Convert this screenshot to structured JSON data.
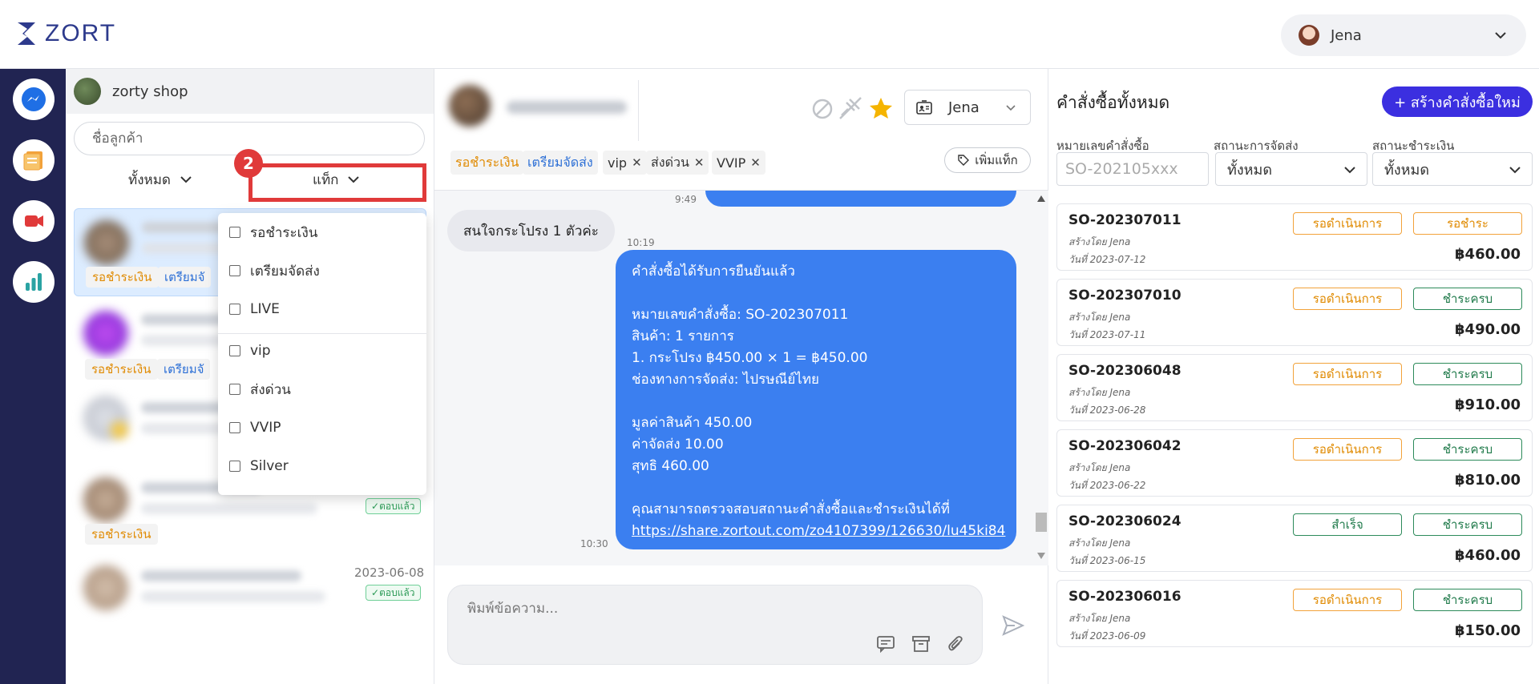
{
  "brand": {
    "name": "ZORT"
  },
  "user_menu": {
    "name": "Jena",
    "icon": "chevron-down-icon"
  },
  "rail": {
    "items": [
      {
        "name": "messenger-icon",
        "color": "#1f6fe5"
      },
      {
        "name": "orders-icon",
        "color": "#f2a23a"
      },
      {
        "name": "live-video-icon",
        "color": "#e03a3a"
      },
      {
        "name": "reports-chart-icon",
        "color": "#2aa3a3"
      }
    ]
  },
  "customer_panel": {
    "shop_name": "zorty shop",
    "search_placeholder": "ชื่อลูกค้า",
    "filter_all": "ทั้งหมด",
    "filter_tag": "แท็ก",
    "step_marker": "2",
    "conversations": [
      {
        "tags": [
          "รอชำระเงิน",
          "เตรียมจั"
        ],
        "time": "",
        "replied": ""
      },
      {
        "tags": [
          "รอชำระเงิน",
          "เตรียมจั"
        ],
        "time": "",
        "replied": ""
      },
      {
        "tags": [],
        "time": "",
        "replied": ""
      },
      {
        "tags": [
          "รอชำระเงิน"
        ],
        "time": "",
        "replied": "ตอบแล้ว"
      },
      {
        "tags": [],
        "time": "2023-06-08",
        "replied": "ตอบแล้ว"
      }
    ]
  },
  "tag_dropdown": {
    "options": [
      "รอชำระเงิน",
      "เตรียมจัดส่ง",
      "LIVE",
      "vip",
      "ส่งด่วน",
      "VVIP",
      "Silver"
    ]
  },
  "chat": {
    "assignee": "Jena",
    "tags": [
      {
        "label": "รอชำระเงิน",
        "removable": false
      },
      {
        "label": "เตรียมจัดส่ง",
        "removable": false
      },
      {
        "label": "vip",
        "removable": true
      },
      {
        "label": "ส่งด่วน",
        "removable": true
      },
      {
        "label": "VVIP",
        "removable": true
      }
    ],
    "add_tag": "เพิ่มแท็ก",
    "messages": {
      "ts_top": "9:49",
      "incoming_text": "สนใจกระโปรง 1 ตัวค่ะ",
      "incoming_time": "10:19",
      "outgoing_time": "10:30",
      "outgoing_lines": [
        "คำสั่งซื้อได้รับการยืนยันแล้ว",
        "",
        "หมายเลขคำสั่งซื้อ: SO-202307011",
        "สินค้า: 1 รายการ",
        "1. กระโปรง ฿450.00 × 1 = ฿450.00",
        "ช่องทางการจัดส่ง: ไปรษณีย์ไทย",
        "",
        "มูลค่าสินค้า 450.00",
        "ค่าจัดส่ง 10.00",
        "สุทธิ 460.00",
        "",
        "คุณสามารถตรวจสอบสถานะคำสั่งซื้อและชำระเงินได้ที่"
      ],
      "outgoing_link": "https://share.zortout.com/zo4107399/126630/lu45ki84"
    },
    "compose_placeholder": "พิมพ์ข้อความ..."
  },
  "orders": {
    "title": "คำสั่งซื้อทั้งหมด",
    "new_button": "+ สร้างคำสั่งซื้อใหม่",
    "filters": {
      "order_no_label": "หมายเลขคำสั่งซื้อ",
      "order_no_placeholder": "SO-202105xxx",
      "shipping_label": "สถานะการจัดส่ง",
      "shipping_value": "ทั้งหมด",
      "payment_label": "สถานะชำระเงิน",
      "payment_value": "ทั้งหมด"
    },
    "list": [
      {
        "no": "SO-202307011",
        "by": "สร้างโดย Jena",
        "date": "วันที่ 2023-07-12",
        "status": "รอดำเนินการ",
        "status_color": "orange",
        "payment": "รอชำระ",
        "payment_color": "orange",
        "amount": "฿460.00"
      },
      {
        "no": "SO-202307010",
        "by": "สร้างโดย Jena",
        "date": "วันที่ 2023-07-11",
        "status": "รอดำเนินการ",
        "status_color": "orange",
        "payment": "ชำระครบ",
        "payment_color": "green",
        "amount": "฿490.00"
      },
      {
        "no": "SO-202306048",
        "by": "สร้างโดย Jena",
        "date": "วันที่ 2023-06-28",
        "status": "รอดำเนินการ",
        "status_color": "orange",
        "payment": "ชำระครบ",
        "payment_color": "green",
        "amount": "฿910.00"
      },
      {
        "no": "SO-202306042",
        "by": "สร้างโดย Jena",
        "date": "วันที่ 2023-06-22",
        "status": "รอดำเนินการ",
        "status_color": "orange",
        "payment": "ชำระครบ",
        "payment_color": "green",
        "amount": "฿810.00"
      },
      {
        "no": "SO-202306024",
        "by": "สร้างโดย Jena",
        "date": "วันที่ 2023-06-15",
        "status": "สำเร็จ",
        "status_color": "green",
        "payment": "ชำระครบ",
        "payment_color": "green",
        "amount": "฿460.00"
      },
      {
        "no": "SO-202306016",
        "by": "สร้างโดย Jena",
        "date": "วันที่ 2023-06-09",
        "status": "รอดำเนินการ",
        "status_color": "orange",
        "payment": "ชำระครบ",
        "payment_color": "green",
        "amount": "฿150.00"
      }
    ]
  }
}
